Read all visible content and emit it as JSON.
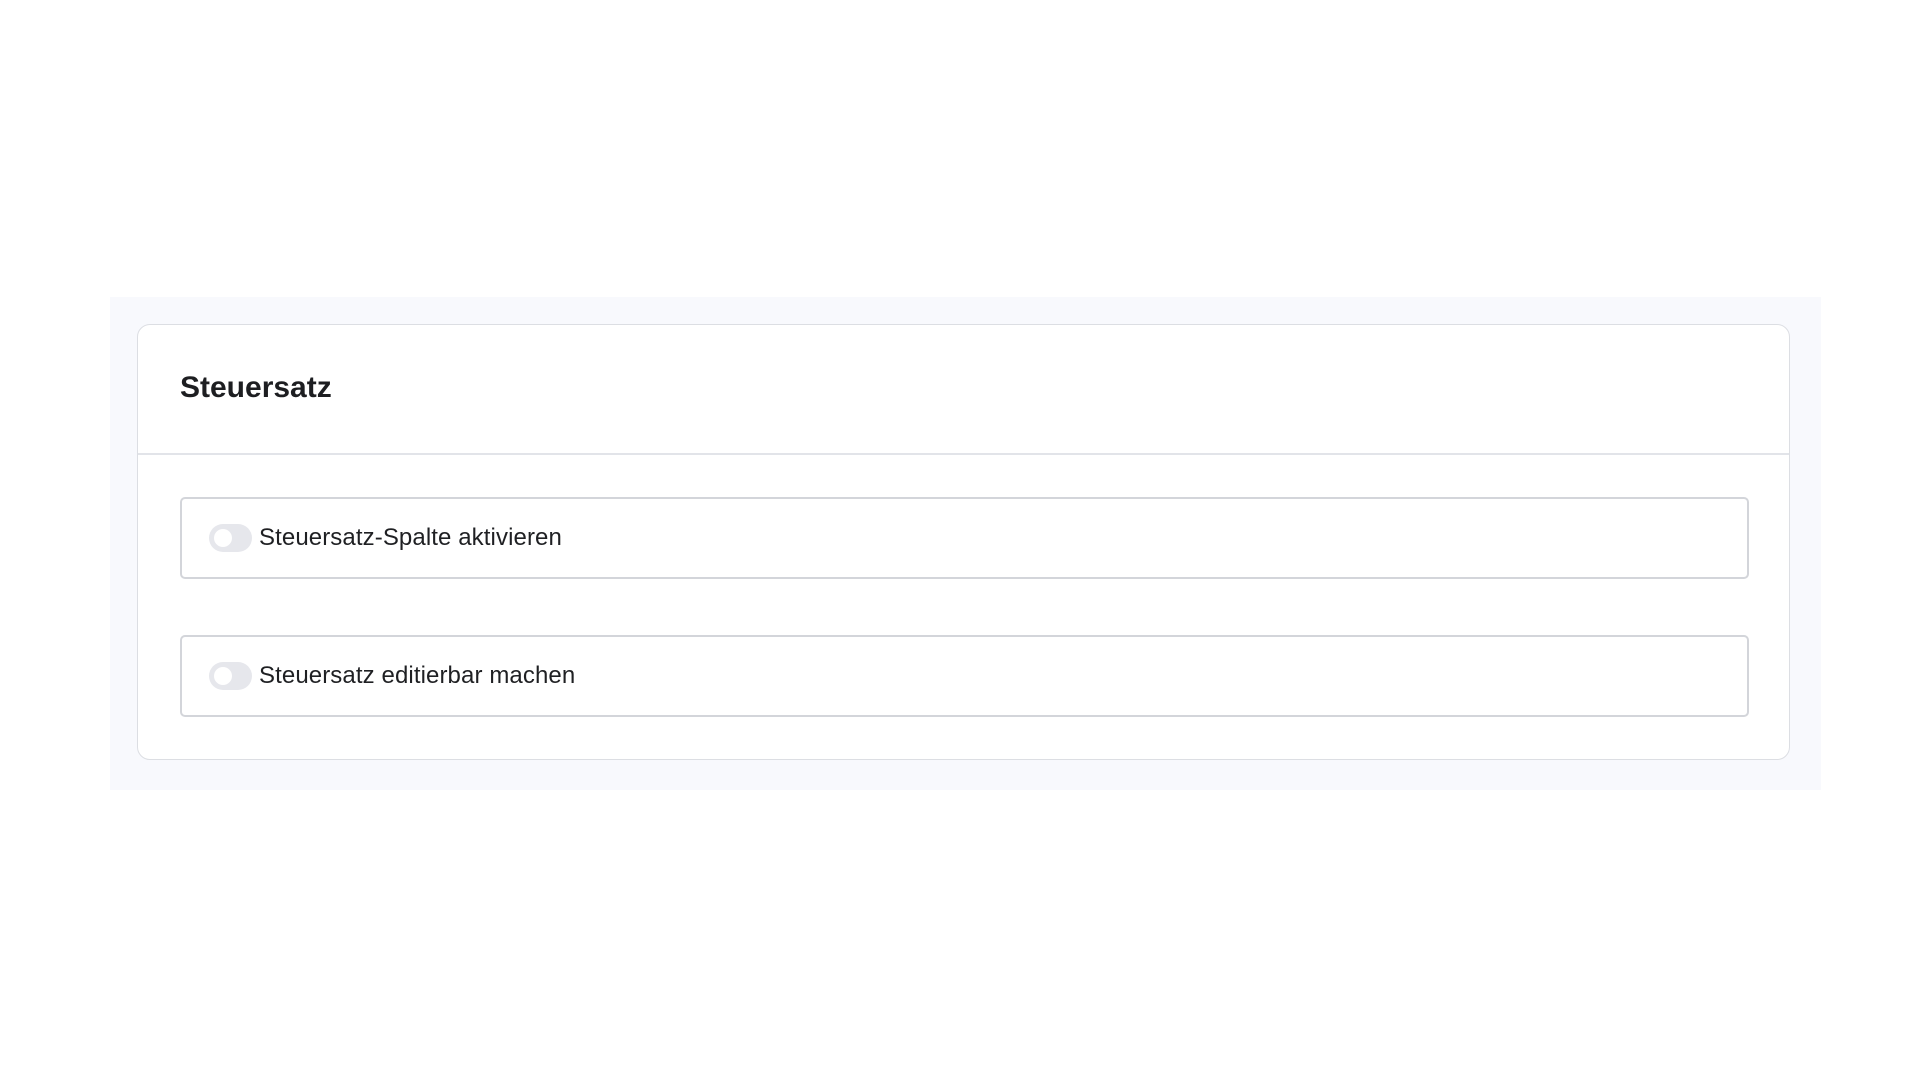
{
  "section": {
    "title": "Steuersatz"
  },
  "settings": [
    {
      "label": "Steuersatz-Spalte aktivieren",
      "enabled": false
    },
    {
      "label": "Steuersatz editierbar machen",
      "enabled": false
    }
  ],
  "colors": {
    "toggle_off_track": "#e6e7ec",
    "panel_background": "#f8f9fd",
    "card_border": "#dcdee3"
  }
}
